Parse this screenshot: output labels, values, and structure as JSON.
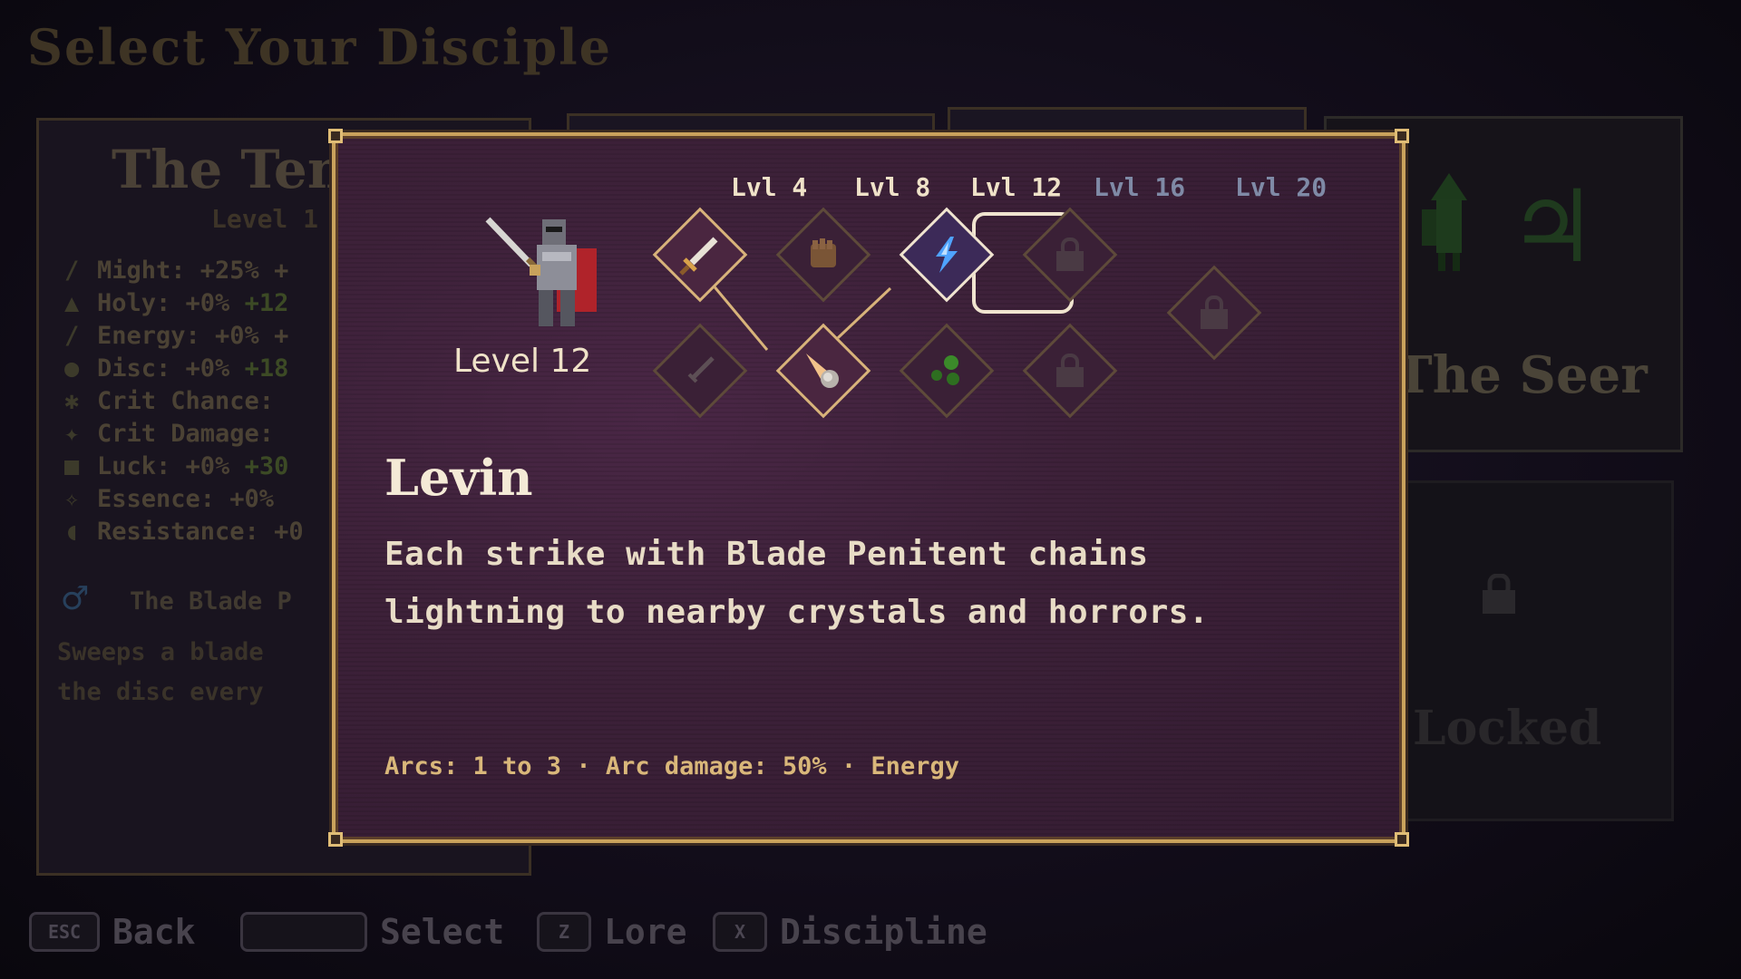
{
  "page_title": "Select Your Disciple",
  "left_card": {
    "name": "The Tem",
    "level": "Level 1",
    "stats": [
      {
        "label": "Might: +25% +",
        "bonus": ""
      },
      {
        "label": "Holy: +0% ",
        "bonus": "+12"
      },
      {
        "label": "Energy: +0% +",
        "bonus": ""
      },
      {
        "label": "Disc: +0% ",
        "bonus": "+18"
      },
      {
        "label": "Crit Chance:",
        "bonus": ""
      },
      {
        "label": "Crit Damage:",
        "bonus": ""
      },
      {
        "label": "Luck: +0% ",
        "bonus": "+30"
      },
      {
        "label": "Essence: +0%",
        "bonus": ""
      },
      {
        "label": "Resistance: +0",
        "bonus": ""
      }
    ],
    "gender_symbol": "♂",
    "ability": "The Blade P",
    "desc_line1": "Sweeps a blade",
    "desc_line2": "the disc every"
  },
  "right_card": {
    "name": "The Seer",
    "symbol": "♃"
  },
  "locked_card": {
    "label": "Locked"
  },
  "footer": {
    "back_key": "ESC",
    "back_label": "Back",
    "select_key": "",
    "select_label": "Select",
    "lore_key": "Z",
    "lore_label": "Lore",
    "discipline_key": "X",
    "discipline_label": "Discipline"
  },
  "modal": {
    "character_level": "Level 12",
    "tier_labels": [
      "Lvl 4",
      "Lvl 8",
      "Lvl 12",
      "Lvl 16",
      "Lvl 20"
    ],
    "nodes": [
      {
        "icon": "sword-icon",
        "state": "unlocked"
      },
      {
        "icon": "fist-icon",
        "state": "available"
      },
      {
        "icon": "lightning-icon",
        "state": "selected"
      },
      {
        "icon": "lock-icon",
        "state": "locked"
      },
      {
        "icon": "lock-icon",
        "state": "locked"
      },
      {
        "icon": "dagger-icon",
        "state": "available"
      },
      {
        "icon": "comet-icon",
        "state": "unlocked"
      },
      {
        "icon": "orbs-icon",
        "state": "available"
      },
      {
        "icon": "lock-icon",
        "state": "locked"
      }
    ],
    "ability_name": "Levin",
    "ability_desc_line1": "Each strike with Blade Penitent chains",
    "ability_desc_line2": "lightning to nearby crystals and horrors.",
    "ability_stats": "Arcs: 1 to 3 · Arc damage: 50% · Energy"
  },
  "colors": {
    "modal_border": "#c9a25c",
    "modal_bg": "#3d2139",
    "tier_active": "#efe2c8",
    "tier_inactive": "#7f8aa6",
    "stats_text": "#d9b77a"
  }
}
